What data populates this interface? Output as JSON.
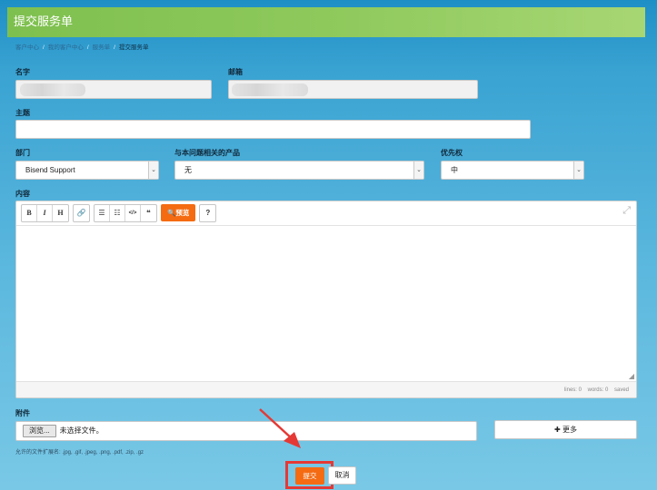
{
  "header": {
    "title": "提交服务单"
  },
  "breadcrumb": [
    "客户中心",
    "我的客户中心",
    "服务单",
    "提交服务单"
  ],
  "form": {
    "name_label": "名字",
    "email_label": "邮箱",
    "subject_label": "主题",
    "subject_value": "",
    "department_label": "部门",
    "department_value": "Bisend Support",
    "product_label": "与本问题相关的产品",
    "product_value": "无",
    "priority_label": "优先权",
    "priority_value": "中",
    "content_label": "内容"
  },
  "editor": {
    "toolbar": {
      "bold": "B",
      "italic": "I",
      "heading": "H",
      "link": "🔗",
      "ul": "☰",
      "ol": "☷",
      "code": "</>",
      "quote": "❝",
      "preview_icon": "🔍",
      "preview": "预览",
      "help": "?"
    },
    "status": {
      "lines": "lines: 0",
      "words": "words: 0",
      "saved": "saved"
    }
  },
  "attachments": {
    "label": "附件",
    "browse_label": "浏览...",
    "no_file": "未选择文件。",
    "more_label": "✚ 更多",
    "allowed_ext": "允许的文件扩展名: .jpg, .gif, .jpeg, .png, .pdf, .zip, .gz"
  },
  "actions": {
    "submit": "提交",
    "cancel": "取消"
  },
  "colors": {
    "accent": "#f46b12",
    "header_green": "#8ec95c",
    "highlight": "#e53935"
  }
}
